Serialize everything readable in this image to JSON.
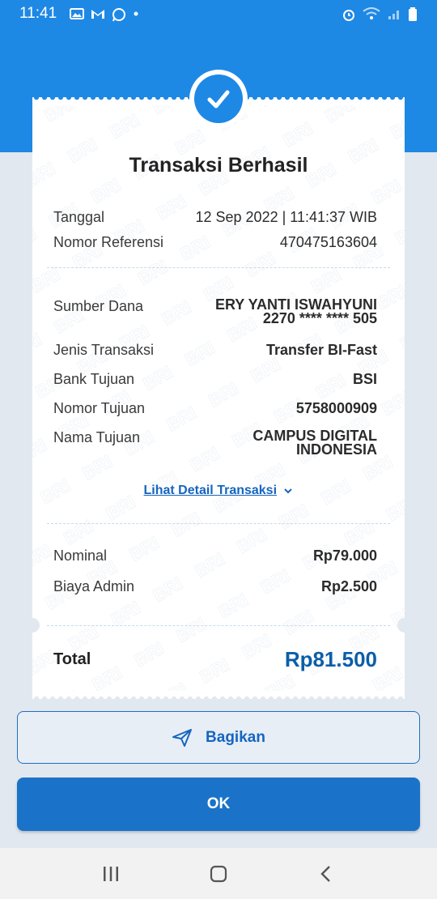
{
  "status_bar": {
    "time": "11:41"
  },
  "receipt": {
    "title": "Transaksi Berhasil",
    "rows_header": [
      {
        "label": "Tanggal",
        "value": "12 Sep 2022 | 11:41:37 WIB"
      },
      {
        "label": "Nomor Referensi",
        "value": "470475163604"
      }
    ],
    "source": {
      "label": "Sumber Dana",
      "name": "ERY YANTI ISWAHYUNI",
      "account": "2270 **** **** 505"
    },
    "rows_detail": [
      {
        "label": "Jenis Transaksi",
        "value": "Transfer BI-Fast"
      },
      {
        "label": "Bank Tujuan",
        "value": "BSI"
      },
      {
        "label": "Nomor Tujuan",
        "value": "5758000909"
      }
    ],
    "destination_name": {
      "label": "Nama Tujuan",
      "line1": "CAMPUS DIGITAL",
      "line2": "INDONESIA"
    },
    "detail_link": "Lihat Detail Transaksi",
    "nominal": {
      "label": "Nominal",
      "value": "Rp79.000"
    },
    "admin_fee": {
      "label": "Biaya Admin",
      "value": "Rp2.500"
    },
    "total": {
      "label": "Total",
      "value": "Rp81.500"
    },
    "watermark_text": "BRI"
  },
  "buttons": {
    "share": "Bagikan",
    "ok": "OK"
  },
  "colors": {
    "primary": "#1e88e5",
    "total_text": "#0b5ea8",
    "ok_button": "#1a73c8"
  }
}
